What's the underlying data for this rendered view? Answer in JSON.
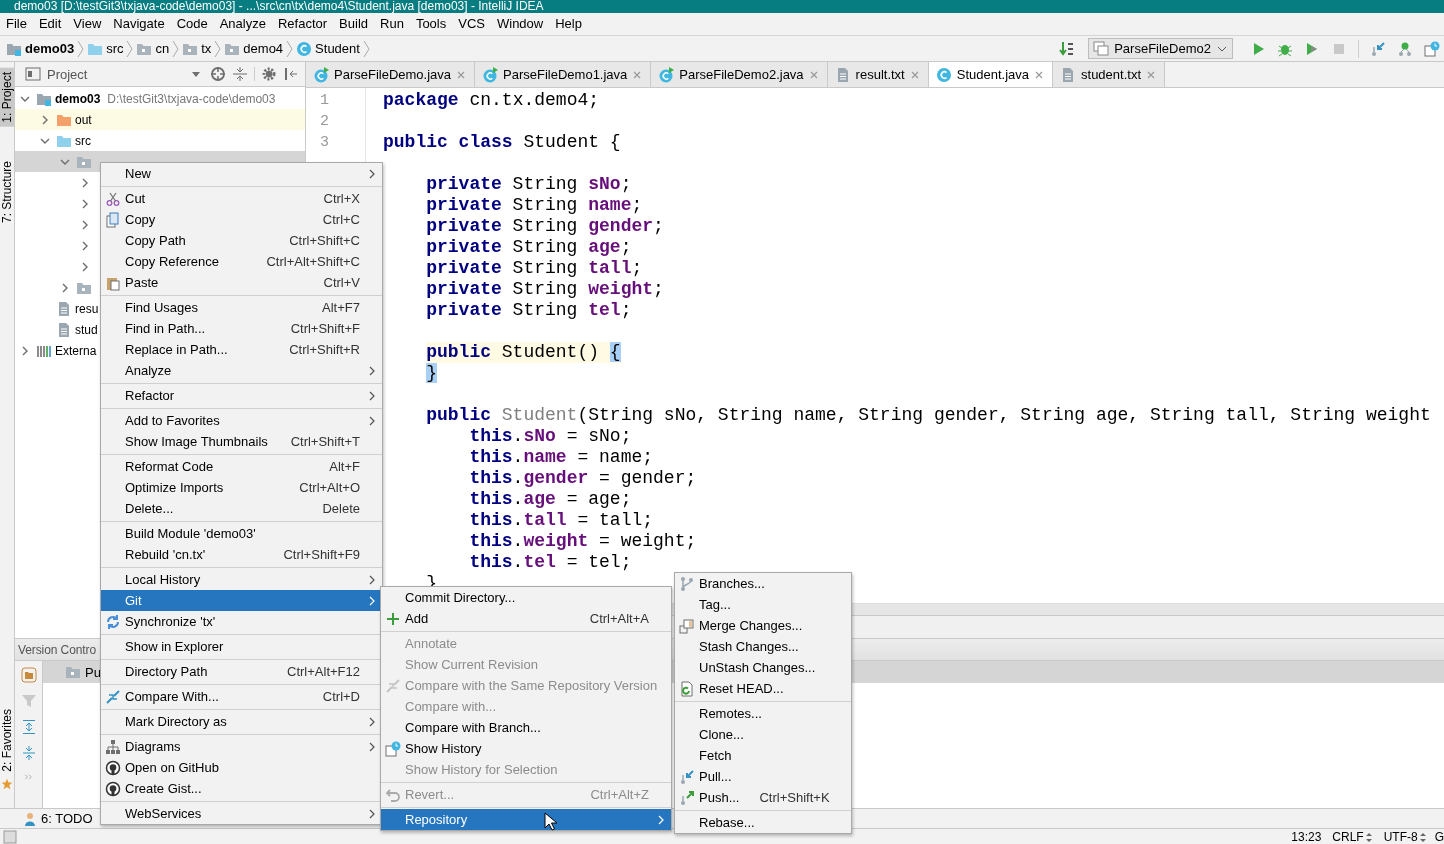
{
  "window": {
    "title": "demo03 [D:\\testGit3\\txjava-code\\demo03] - ...\\src\\cn\\tx\\demo4\\Student.java [demo03] - IntelliJ IDEA"
  },
  "menu_bar": [
    "File",
    "Edit",
    "View",
    "Navigate",
    "Code",
    "Analyze",
    "Refactor",
    "Build",
    "Run",
    "Tools",
    "VCS",
    "Window",
    "Help"
  ],
  "breadcrumbs": [
    {
      "label": "demo03",
      "kind": "module"
    },
    {
      "label": "src",
      "kind": "source"
    },
    {
      "label": "cn",
      "kind": "package"
    },
    {
      "label": "tx",
      "kind": "package"
    },
    {
      "label": "demo4",
      "kind": "package"
    },
    {
      "label": "Student",
      "kind": "class"
    }
  ],
  "run_configuration": {
    "label": "ParseFileDemo2"
  },
  "tool_strip": [
    {
      "label": "1: Project",
      "selected": true
    },
    {
      "label": "7: Structure",
      "selected": false
    },
    {
      "label": "2: Favorites",
      "selected": false
    }
  ],
  "project_panel": {
    "title": "Project",
    "tree": [
      {
        "label": "demo03",
        "path": "D:\\testGit3\\txjava-code\\demo03",
        "kind": "module",
        "expanded": true,
        "selected": false,
        "children": [
          {
            "label": "out",
            "kind": "excluded",
            "expanded": false,
            "selected": false
          },
          {
            "label": "src",
            "kind": "source",
            "expanded": true,
            "selected": false,
            "children": [
              {
                "kind": "package",
                "expanded": true,
                "selected": true,
                "children": [
                  {
                    "expanded": false,
                    "selected": false
                  },
                  {
                    "expanded": false,
                    "selected": false
                  },
                  {
                    "expanded": false,
                    "selected": false
                  },
                  {
                    "expanded": false,
                    "selected": false
                  },
                  {
                    "expanded": false,
                    "selected": false
                  }
                ]
              },
              {
                "kind": "package",
                "expanded": false,
                "selected": false
              }
            ]
          },
          {
            "label": "resu",
            "kind": "file",
            "selected": false
          },
          {
            "label": "stud",
            "kind": "file",
            "selected": false
          }
        ]
      },
      {
        "label": "Externa",
        "kind": "library",
        "expanded": false,
        "selected": false
      }
    ]
  },
  "editor": {
    "tabs": [
      {
        "label": "ParseFileDemo.java",
        "kind": "runnable",
        "selected": false
      },
      {
        "label": "ParseFileDemo1.java",
        "kind": "runnable",
        "selected": false
      },
      {
        "label": "ParseFileDemo2.java",
        "kind": "runnable",
        "selected": false
      },
      {
        "label": "result.txt",
        "kind": "text",
        "selected": false
      },
      {
        "label": "Student.java",
        "kind": "class",
        "selected": true
      },
      {
        "label": "student.txt",
        "kind": "text",
        "selected": false
      }
    ],
    "gutter": [
      "1",
      "2",
      "3"
    ],
    "lines": [
      {
        "kind": "top",
        "highlighted": false,
        "tokens": [
          {
            "text": "package",
            "kind": "keyword"
          },
          {
            "text": " cn.tx.demo4;",
            "kind": "plain"
          }
        ]
      },
      {
        "kind": "blank"
      },
      {
        "kind": "top",
        "highlighted": false,
        "tokens": [
          {
            "text": "public class",
            "kind": "keyword"
          },
          {
            "text": " Student {",
            "kind": "plain"
          }
        ]
      },
      {
        "kind": "blank"
      },
      {
        "kind": "member",
        "highlighted": false,
        "tokens": [
          {
            "text": "private",
            "kind": "keyword"
          },
          {
            "text": " String ",
            "kind": "plain"
          },
          {
            "text": "sNo",
            "kind": "field"
          },
          {
            "text": ";",
            "kind": "plain"
          }
        ]
      },
      {
        "kind": "member",
        "highlighted": false,
        "tokens": [
          {
            "text": "private",
            "kind": "keyword"
          },
          {
            "text": " String ",
            "kind": "plain"
          },
          {
            "text": "name",
            "kind": "field"
          },
          {
            "text": ";",
            "kind": "plain"
          }
        ]
      },
      {
        "kind": "member",
        "highlighted": false,
        "tokens": [
          {
            "text": "private",
            "kind": "keyword"
          },
          {
            "text": " String ",
            "kind": "plain"
          },
          {
            "text": "gender",
            "kind": "field"
          },
          {
            "text": ";",
            "kind": "plain"
          }
        ]
      },
      {
        "kind": "member",
        "highlighted": false,
        "tokens": [
          {
            "text": "private",
            "kind": "keyword"
          },
          {
            "text": " String ",
            "kind": "plain"
          },
          {
            "text": "age",
            "kind": "field"
          },
          {
            "text": ";",
            "kind": "plain"
          }
        ]
      },
      {
        "kind": "member",
        "highlighted": false,
        "tokens": [
          {
            "text": "private",
            "kind": "keyword"
          },
          {
            "text": " String ",
            "kind": "plain"
          },
          {
            "text": "tall",
            "kind": "field"
          },
          {
            "text": ";",
            "kind": "plain"
          }
        ]
      },
      {
        "kind": "member",
        "highlighted": false,
        "tokens": [
          {
            "text": "private",
            "kind": "keyword"
          },
          {
            "text": " String ",
            "kind": "plain"
          },
          {
            "text": "weight",
            "kind": "field"
          },
          {
            "text": ";",
            "kind": "plain"
          }
        ]
      },
      {
        "kind": "member",
        "highlighted": false,
        "tokens": [
          {
            "text": "private",
            "kind": "keyword"
          },
          {
            "text": " String ",
            "kind": "plain"
          },
          {
            "text": "tel",
            "kind": "field"
          },
          {
            "text": ";",
            "kind": "plain"
          }
        ]
      },
      {
        "kind": "blank"
      },
      {
        "kind": "member",
        "highlighted": true,
        "tokens": [
          {
            "text": "public",
            "kind": "keyword"
          },
          {
            "text": " Student() ",
            "kind": "plain"
          },
          {
            "text": "{",
            "kind": "brace"
          }
        ]
      },
      {
        "kind": "member",
        "highlighted": false,
        "tokens": [
          {
            "text": "}",
            "kind": "brace"
          }
        ]
      },
      {
        "kind": "blank"
      },
      {
        "kind": "member",
        "highlighted": false,
        "tokens": [
          {
            "text": "public",
            "kind": "keyword"
          },
          {
            "text": " Student",
            "kind": "unused"
          },
          {
            "text": "(String sNo, String name, String gender, String age, String tall, String weight",
            "kind": "plain"
          }
        ]
      },
      {
        "kind": "body",
        "highlighted": false,
        "tokens": [
          {
            "text": "this",
            "kind": "keyword"
          },
          {
            "text": ".",
            "kind": "plain"
          },
          {
            "text": "sNo",
            "kind": "field"
          },
          {
            "text": " = sNo;",
            "kind": "plain"
          }
        ]
      },
      {
        "kind": "body",
        "highlighted": false,
        "tokens": [
          {
            "text": "this",
            "kind": "keyword"
          },
          {
            "text": ".",
            "kind": "plain"
          },
          {
            "text": "name",
            "kind": "field"
          },
          {
            "text": " = name;",
            "kind": "plain"
          }
        ]
      },
      {
        "kind": "body",
        "highlighted": false,
        "tokens": [
          {
            "text": "this",
            "kind": "keyword"
          },
          {
            "text": ".",
            "kind": "plain"
          },
          {
            "text": "gender",
            "kind": "field"
          },
          {
            "text": " = gender;",
            "kind": "plain"
          }
        ]
      },
      {
        "kind": "body",
        "highlighted": false,
        "tokens": [
          {
            "text": "this",
            "kind": "keyword"
          },
          {
            "text": ".",
            "kind": "plain"
          },
          {
            "text": "age",
            "kind": "field"
          },
          {
            "text": " = age;",
            "kind": "plain"
          }
        ]
      },
      {
        "kind": "body",
        "highlighted": false,
        "tokens": [
          {
            "text": "this",
            "kind": "keyword"
          },
          {
            "text": ".",
            "kind": "plain"
          },
          {
            "text": "tall",
            "kind": "field"
          },
          {
            "text": " = tall;",
            "kind": "plain"
          }
        ]
      },
      {
        "kind": "body",
        "highlighted": false,
        "tokens": [
          {
            "text": "this",
            "kind": "keyword"
          },
          {
            "text": ".",
            "kind": "plain"
          },
          {
            "text": "weight",
            "kind": "field"
          },
          {
            "text": " = weight;",
            "kind": "plain"
          }
        ]
      },
      {
        "kind": "body",
        "highlighted": false,
        "tokens": [
          {
            "text": "this",
            "kind": "keyword"
          },
          {
            "text": ".",
            "kind": "plain"
          },
          {
            "text": "tel",
            "kind": "field"
          },
          {
            "text": " = tel;",
            "kind": "plain"
          }
        ]
      },
      {
        "kind": "member",
        "highlighted": false,
        "tokens": [
          {
            "text": "}",
            "kind": "plain"
          }
        ]
      }
    ]
  },
  "version_control": {
    "title": "Version Contro",
    "rows": [
      {
        "label": "Pu",
        "selected": true
      }
    ]
  },
  "bottom_tabs": [
    {
      "label": "6: TODO"
    }
  ],
  "status_bar": {
    "position": "13:23",
    "line_separator": "CRLF",
    "encoding": "UTF-8",
    "column_4": "G"
  },
  "context_menus": [
    {
      "groups": [
        [
          {
            "label": "New",
            "submenu": true,
            "selected": false
          }
        ],
        [
          {
            "label": "Cut",
            "shortcut": "Ctrl+X",
            "submenu": false,
            "selected": false
          },
          {
            "label": "Copy",
            "shortcut": "Ctrl+C",
            "submenu": false,
            "selected": false
          },
          {
            "label": "Copy Path",
            "shortcut": "Ctrl+Shift+C",
            "submenu": false,
            "selected": false
          },
          {
            "label": "Copy Reference",
            "shortcut": "Ctrl+Alt+Shift+C",
            "submenu": false,
            "selected": false
          },
          {
            "label": "Paste",
            "shortcut": "Ctrl+V",
            "submenu": false,
            "selected": false
          }
        ],
        [
          {
            "label": "Find Usages",
            "shortcut": "Alt+F7",
            "submenu": false,
            "selected": false
          },
          {
            "label": "Find in Path...",
            "shortcut": "Ctrl+Shift+F",
            "submenu": false,
            "selected": false
          },
          {
            "label": "Replace in Path...",
            "shortcut": "Ctrl+Shift+R",
            "submenu": false,
            "selected": false
          },
          {
            "label": "Analyze",
            "submenu": true,
            "selected": false
          }
        ],
        [
          {
            "label": "Refactor",
            "submenu": true,
            "selected": false
          }
        ],
        [
          {
            "label": "Add to Favorites",
            "submenu": true,
            "selected": false
          },
          {
            "label": "Show Image Thumbnails",
            "shortcut": "Ctrl+Shift+T",
            "submenu": false,
            "selected": false
          }
        ],
        [
          {
            "label": "Reformat Code",
            "shortcut": "Alt+F",
            "submenu": false,
            "selected": false
          },
          {
            "label": "Optimize Imports",
            "shortcut": "Ctrl+Alt+O",
            "submenu": false,
            "selected": false
          },
          {
            "label": "Delete...",
            "shortcut": "Delete",
            "submenu": false,
            "selected": false
          }
        ],
        [
          {
            "label": "Build Module 'demo03'",
            "submenu": false,
            "selected": false
          },
          {
            "label": "Rebuild 'cn.tx'",
            "shortcut": "Ctrl+Shift+F9",
            "submenu": false,
            "selected": false
          }
        ],
        [
          {
            "label": "Local History",
            "submenu": true,
            "selected": false
          },
          {
            "label": "Git",
            "submenu": true,
            "selected": true
          },
          {
            "label": "Synchronize 'tx'",
            "submenu": false,
            "selected": false
          }
        ],
        [
          {
            "label": "Show in Explorer",
            "submenu": false,
            "selected": false
          }
        ],
        [
          {
            "label": "Directory Path",
            "shortcut": "Ctrl+Alt+F12",
            "submenu": false,
            "selected": false
          }
        ],
        [
          {
            "label": "Compare With...",
            "shortcut": "Ctrl+D",
            "submenu": false,
            "selected": false
          }
        ],
        [
          {
            "label": "Mark Directory as",
            "submenu": true,
            "selected": false
          }
        ],
        [
          {
            "label": "Diagrams",
            "submenu": true,
            "selected": false
          },
          {
            "label": "Open on GitHub",
            "submenu": false,
            "selected": false
          },
          {
            "label": "Create Gist...",
            "submenu": false,
            "selected": false
          }
        ],
        [
          {
            "label": "WebServices",
            "submenu": true,
            "selected": false
          }
        ]
      ]
    },
    {
      "groups": [
        [
          {
            "label": "Commit Directory...",
            "submenu": false,
            "selected": false,
            "disabled": false
          },
          {
            "label": "Add",
            "shortcut": "Ctrl+Alt+A",
            "submenu": false,
            "selected": false,
            "disabled": false
          }
        ],
        [
          {
            "label": "Annotate",
            "submenu": false,
            "selected": false,
            "disabled": true
          },
          {
            "label": "Show Current Revision",
            "submenu": false,
            "selected": false,
            "disabled": true
          },
          {
            "label": "Compare with the Same Repository Version",
            "submenu": false,
            "selected": false,
            "disabled": true
          },
          {
            "label": "Compare with...",
            "submenu": false,
            "selected": false,
            "disabled": true
          },
          {
            "label": "Compare with Branch...",
            "submenu": false,
            "selected": false,
            "disabled": false
          },
          {
            "label": "Show History",
            "submenu": false,
            "selected": false,
            "disabled": false
          },
          {
            "label": "Show History for Selection",
            "submenu": false,
            "selected": false,
            "disabled": true
          }
        ],
        [
          {
            "label": "Revert...",
            "shortcut": "Ctrl+Alt+Z",
            "submenu": false,
            "selected": false,
            "disabled": true
          }
        ],
        [
          {
            "label": "Repository",
            "submenu": true,
            "selected": true,
            "disabled": false
          }
        ]
      ]
    },
    {
      "groups": [
        [
          {
            "label": "Branches...",
            "submenu": false,
            "selected": false
          },
          {
            "label": "Tag...",
            "submenu": false,
            "selected": false
          },
          {
            "label": "Merge Changes...",
            "submenu": false,
            "selected": false
          },
          {
            "label": "Stash Changes...",
            "submenu": false,
            "selected": false
          },
          {
            "label": "UnStash Changes...",
            "submenu": false,
            "selected": false
          },
          {
            "label": "Reset HEAD...",
            "submenu": false,
            "selected": false
          }
        ],
        [
          {
            "label": "Remotes...",
            "submenu": false,
            "selected": false
          },
          {
            "label": "Clone...",
            "submenu": false,
            "selected": false
          },
          {
            "label": "Fetch",
            "submenu": false,
            "selected": false
          },
          {
            "label": "Pull...",
            "submenu": false,
            "selected": false
          },
          {
            "label": "Push...",
            "shortcut": "Ctrl+Shift+K",
            "submenu": false,
            "selected": false
          }
        ],
        [
          {
            "label": "Rebase...",
            "submenu": false,
            "selected": false
          }
        ]
      ]
    }
  ]
}
